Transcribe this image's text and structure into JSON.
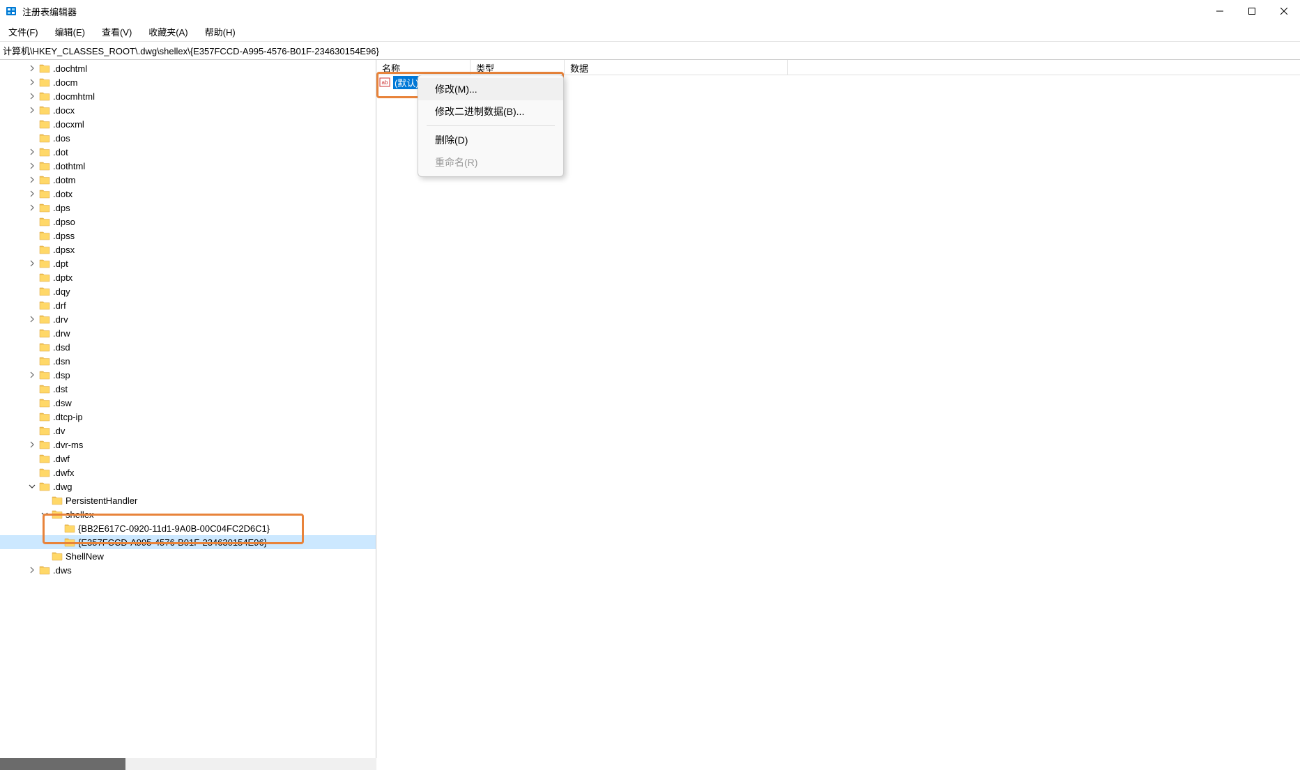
{
  "window": {
    "title": "注册表编辑器"
  },
  "menu": {
    "file": "文件(F)",
    "edit": "编辑(E)",
    "view": "查看(V)",
    "favorites": "收藏夹(A)",
    "help": "帮助(H)"
  },
  "address": "计算机\\HKEY_CLASSES_ROOT\\.dwg\\shellex\\{E357FCCD-A995-4576-B01F-234630154E96}",
  "tree": [
    {
      "indent": 2,
      "exp": "col",
      "label": ".dochtml"
    },
    {
      "indent": 2,
      "exp": "col",
      "label": ".docm"
    },
    {
      "indent": 2,
      "exp": "col",
      "label": ".docmhtml"
    },
    {
      "indent": 2,
      "exp": "col",
      "label": ".docx"
    },
    {
      "indent": 2,
      "exp": "none",
      "label": ".docxml"
    },
    {
      "indent": 2,
      "exp": "none",
      "label": ".dos"
    },
    {
      "indent": 2,
      "exp": "col",
      "label": ".dot"
    },
    {
      "indent": 2,
      "exp": "col",
      "label": ".dothtml"
    },
    {
      "indent": 2,
      "exp": "col",
      "label": ".dotm"
    },
    {
      "indent": 2,
      "exp": "col",
      "label": ".dotx"
    },
    {
      "indent": 2,
      "exp": "col",
      "label": ".dps"
    },
    {
      "indent": 2,
      "exp": "none",
      "label": ".dpso"
    },
    {
      "indent": 2,
      "exp": "none",
      "label": ".dpss"
    },
    {
      "indent": 2,
      "exp": "none",
      "label": ".dpsx"
    },
    {
      "indent": 2,
      "exp": "col",
      "label": ".dpt"
    },
    {
      "indent": 2,
      "exp": "none",
      "label": ".dptx"
    },
    {
      "indent": 2,
      "exp": "none",
      "label": ".dqy"
    },
    {
      "indent": 2,
      "exp": "none",
      "label": ".drf"
    },
    {
      "indent": 2,
      "exp": "col",
      "label": ".drv"
    },
    {
      "indent": 2,
      "exp": "none",
      "label": ".drw"
    },
    {
      "indent": 2,
      "exp": "none",
      "label": ".dsd"
    },
    {
      "indent": 2,
      "exp": "none",
      "label": ".dsn"
    },
    {
      "indent": 2,
      "exp": "col",
      "label": ".dsp"
    },
    {
      "indent": 2,
      "exp": "none",
      "label": ".dst"
    },
    {
      "indent": 2,
      "exp": "none",
      "label": ".dsw"
    },
    {
      "indent": 2,
      "exp": "none",
      "label": ".dtcp-ip"
    },
    {
      "indent": 2,
      "exp": "none",
      "label": ".dv"
    },
    {
      "indent": 2,
      "exp": "col",
      "label": ".dvr-ms"
    },
    {
      "indent": 2,
      "exp": "none",
      "label": ".dwf"
    },
    {
      "indent": 2,
      "exp": "none",
      "label": ".dwfx"
    },
    {
      "indent": 2,
      "exp": "exp",
      "label": ".dwg"
    },
    {
      "indent": 3,
      "exp": "none",
      "label": "PersistentHandler"
    },
    {
      "indent": 3,
      "exp": "exp",
      "label": "shellex"
    },
    {
      "indent": 4,
      "exp": "none",
      "label": "{BB2E617C-0920-11d1-9A0B-00C04FC2D6C1}"
    },
    {
      "indent": 4,
      "exp": "none",
      "label": "{E357FCCD-A995-4576-B01F-234630154E96}",
      "selected": true
    },
    {
      "indent": 3,
      "exp": "none",
      "label": "ShellNew"
    },
    {
      "indent": 2,
      "exp": "col",
      "label": ".dws"
    }
  ],
  "list": {
    "headers": {
      "name": "名称",
      "type": "类型",
      "data": "数据"
    },
    "row": {
      "name": "(默认)",
      "type": "",
      "data": ""
    }
  },
  "context_menu": {
    "modify": "修改(M)...",
    "modify_binary": "修改二进制数据(B)...",
    "delete": "删除(D)",
    "rename": "重命名(R)"
  }
}
